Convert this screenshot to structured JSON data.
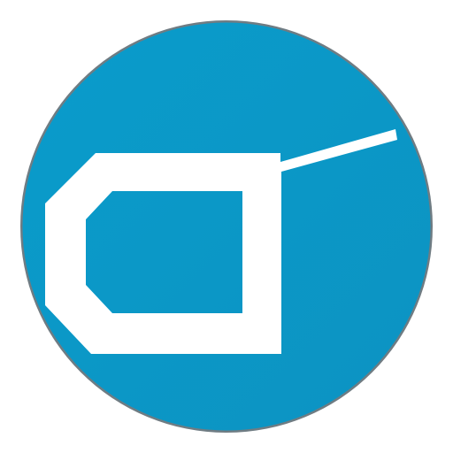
{
  "icon": {
    "name": "tool-glyph-icon",
    "colors": {
      "circle_fill": "#0A9CCB",
      "circle_fill_dark": "#0C93C2",
      "circle_rim": "#6F7C83",
      "glyph": "#FFFFFF",
      "background": "#FFFFFF"
    }
  }
}
